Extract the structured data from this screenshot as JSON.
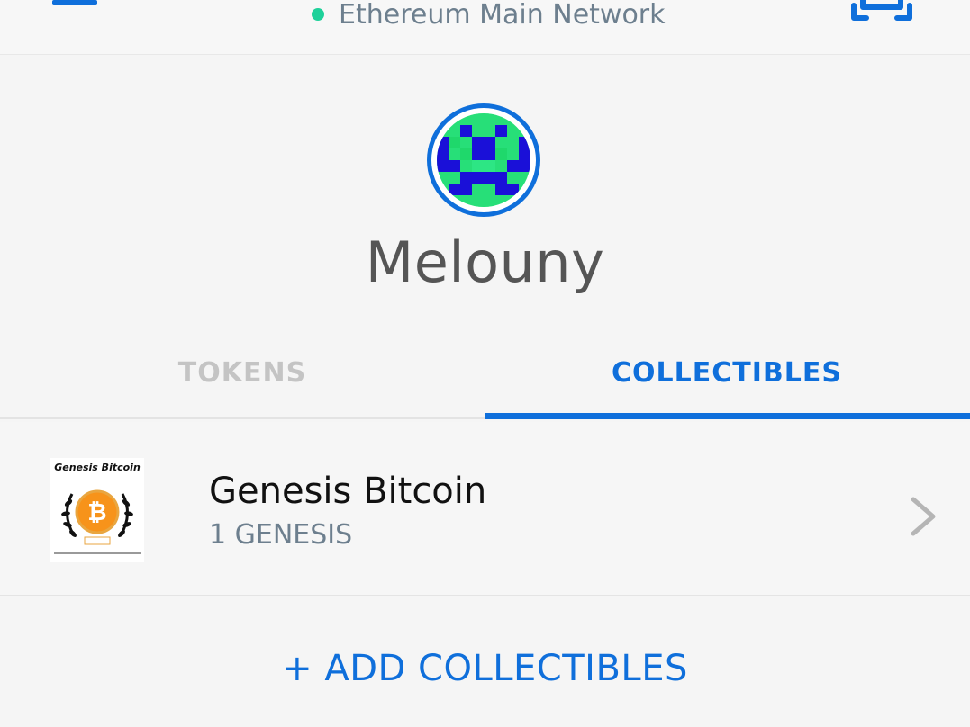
{
  "header": {
    "network_name": "Ethereum Main Network",
    "network_status_color": "#1fd19a",
    "menu_icon": "hamburger-menu-icon",
    "scan_icon": "qr-scan-icon"
  },
  "account": {
    "name": "Melouny",
    "avatar_icon": "identicon-avatar"
  },
  "tabs": [
    {
      "label": "TOKENS",
      "active": false
    },
    {
      "label": "COLLECTIBLES",
      "active": true
    }
  ],
  "collectibles": [
    {
      "name": "Genesis Bitcoin",
      "amount": "1 GENESIS",
      "thumbnail_title": "Genesis Bitcoin",
      "thumbnail_icon": "bitcoin-coin-icon"
    }
  ],
  "actions": {
    "add_collectibles": "+ ADD COLLECTIBLES"
  },
  "colors": {
    "accent": "#0f6fdb",
    "inactive_tab": "#c4c4c4",
    "secondary_text": "#6d7f8e"
  }
}
